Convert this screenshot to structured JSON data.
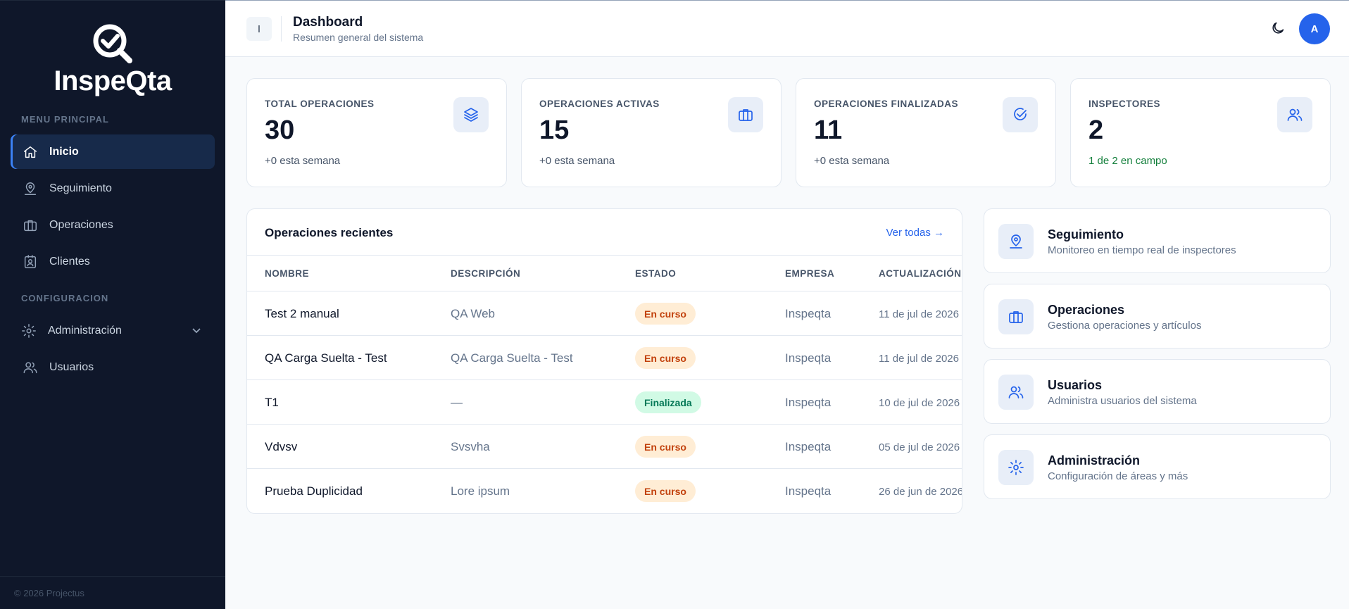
{
  "sidebar": {
    "logo_text": "InspeQta",
    "section_main": "MENU PRINCIPAL",
    "section_config": "CONFIGURACION",
    "items": [
      {
        "label": "Inicio",
        "icon": "home-icon"
      },
      {
        "label": "Seguimiento",
        "icon": "map-pin-user-icon"
      },
      {
        "label": "Operaciones",
        "icon": "briefcase-icon"
      },
      {
        "label": "Clientes",
        "icon": "id-badge-icon"
      },
      {
        "label": "Administración",
        "icon": "gear-icon"
      },
      {
        "label": "Usuarios",
        "icon": "users-icon"
      }
    ],
    "footer": "© 2026 Projectus"
  },
  "header": {
    "toggle_label": "I",
    "title": "Dashboard",
    "subtitle": "Resumen general del sistema",
    "avatar_initial": "A"
  },
  "stats": [
    {
      "label": "TOTAL OPERACIONES",
      "value": "30",
      "note": "+0 esta semana",
      "icon": "layers-icon"
    },
    {
      "label": "OPERACIONES ACTIVAS",
      "value": "15",
      "note": "+0 esta semana",
      "icon": "briefcase-icon"
    },
    {
      "label": "OPERACIONES FINALIZADAS",
      "value": "11",
      "note": "+0 esta semana",
      "icon": "check-circle-icon"
    },
    {
      "label": "INSPECTORES",
      "value": "2",
      "note": "1 de 2 en campo",
      "icon": "users-icon"
    }
  ],
  "recent": {
    "title": "Operaciones recientes",
    "link": "Ver todas →",
    "columns": [
      "NOMBRE",
      "DESCRIPCIÓN",
      "ESTADO",
      "EMPRESA",
      "ACTUALIZACIÓN"
    ],
    "rows": [
      {
        "name": "Test 2 manual",
        "desc": "QA Web",
        "status": "En curso",
        "company": "Inspeqta",
        "date": "11 de jul de 2026"
      },
      {
        "name": "QA Carga Suelta - Test",
        "desc": "QA Carga Suelta - Test",
        "status": "En curso",
        "company": "Inspeqta",
        "date": "11 de jul de 2026"
      },
      {
        "name": "T1",
        "desc": "—",
        "status": "Finalizada",
        "company": "Inspeqta",
        "date": "10 de jul de 2026"
      },
      {
        "name": "Vdvsv",
        "desc": "Svsvha",
        "status": "En curso",
        "company": "Inspeqta",
        "date": "05 de jul de 2026"
      },
      {
        "name": "Prueba Duplicidad",
        "desc": "Lore ipsum",
        "status": "En curso",
        "company": "Inspeqta",
        "date": "26 de jun de 2026"
      }
    ]
  },
  "quick_links": [
    {
      "title": "Seguimiento",
      "desc": "Monitoreo en tiempo real de inspectores",
      "icon": "map-pin-user-icon"
    },
    {
      "title": "Operaciones",
      "desc": "Gestiona operaciones y artículos",
      "icon": "briefcase-icon"
    },
    {
      "title": "Usuarios",
      "desc": "Administra usuarios del sistema",
      "icon": "users-icon"
    },
    {
      "title": "Administración",
      "desc": "Configuración de áreas y más",
      "icon": "gear-icon"
    }
  ],
  "colors": {
    "sidebar_bg": "#0f172a",
    "accent": "#2563eb",
    "status_in_progress_bg": "#ffedd5",
    "status_in_progress_text": "#c2410c",
    "status_done_bg": "#d1fae5",
    "status_done_text": "#047857"
  }
}
